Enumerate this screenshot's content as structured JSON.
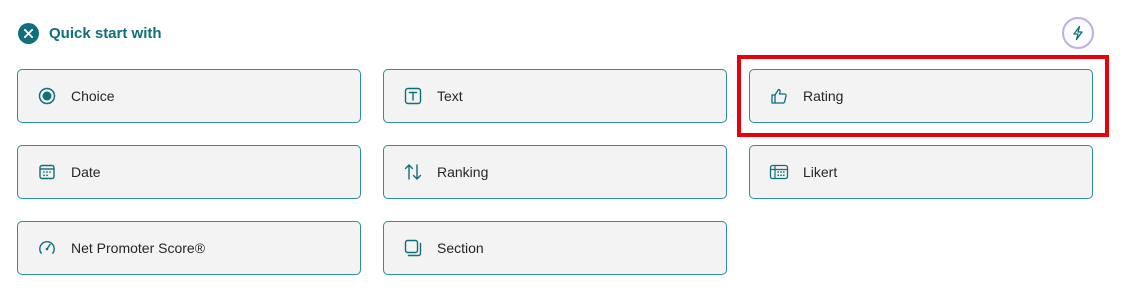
{
  "header": {
    "title": "Quick start with"
  },
  "colors": {
    "accent": "#0f6f7a",
    "card_border": "#2f8f98",
    "card_bg": "#f3f3f3",
    "highlight": "#e8000b"
  },
  "options": [
    {
      "label": "Choice",
      "icon": "radio-icon"
    },
    {
      "label": "Text",
      "icon": "text-icon"
    },
    {
      "label": "Rating",
      "icon": "thumbs-up-icon"
    },
    {
      "label": "Date",
      "icon": "calendar-icon"
    },
    {
      "label": "Ranking",
      "icon": "ranking-arrows-icon"
    },
    {
      "label": "Likert",
      "icon": "likert-icon"
    },
    {
      "label": "Net Promoter Score®",
      "icon": "gauge-icon"
    },
    {
      "label": "Section",
      "icon": "section-icon"
    }
  ]
}
